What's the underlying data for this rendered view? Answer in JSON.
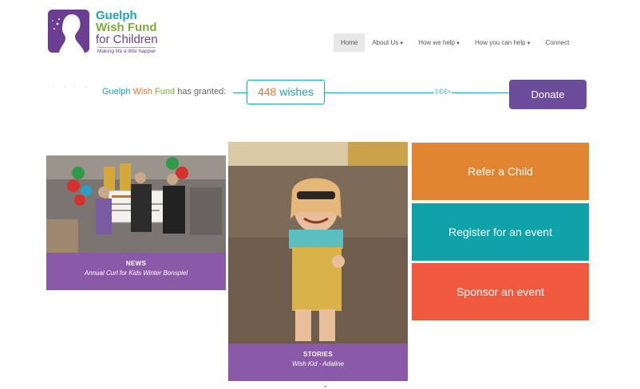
{
  "logo": {
    "line1": "Guelph",
    "line2": "Wish Fund",
    "line3": "for Children",
    "tagline": "Making life a little happier"
  },
  "nav": {
    "items": [
      {
        "label": "Home",
        "active": true,
        "dropdown": false
      },
      {
        "label": "About Us",
        "active": false,
        "dropdown": true
      },
      {
        "label": "How we help",
        "active": false,
        "dropdown": true
      },
      {
        "label": "How you can help",
        "active": false,
        "dropdown": true
      },
      {
        "label": "Connect",
        "active": false,
        "dropdown": false
      }
    ]
  },
  "granted": {
    "guelph": "Guelph",
    "wish": "Wish",
    "fund": "Fund",
    "suffix": "has granted:",
    "count": "448",
    "unit": "wishes"
  },
  "donate_label": "Donate",
  "news": {
    "category": "NEWS",
    "title": "Annual Curl for Kids Winter Bonspiel"
  },
  "story": {
    "category": "STORIES",
    "title": "Wish Kid - Adaline"
  },
  "cta": {
    "refer": "Refer a Child",
    "register": "Register for an event",
    "sponsor": "Sponsor an event"
  },
  "colors": {
    "purple": "#6b3e91",
    "teal": "#1ea3b0",
    "orange": "#e1842f",
    "red": "#ef5a3f",
    "green": "#7cae3a"
  }
}
